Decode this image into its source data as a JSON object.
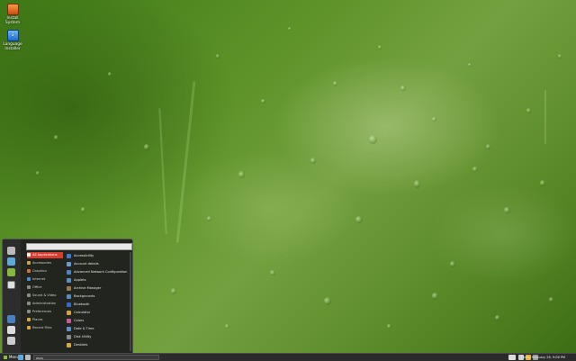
{
  "desktop": {
    "icons": [
      {
        "label": "Install System",
        "icon": "installer-icon"
      },
      {
        "label": "Language Installer",
        "icon": "language-icon"
      }
    ]
  },
  "menu": {
    "search_placeholder": "",
    "categories": [
      {
        "label": "All Applications",
        "icon": "all-apps-icon",
        "color": "#d83c2e",
        "active": true
      },
      {
        "label": "Accessories",
        "icon": "accessories-icon",
        "color": "#c9a24a"
      },
      {
        "label": "Graphics",
        "icon": "graphics-icon",
        "color": "#e0703a"
      },
      {
        "label": "Internet",
        "icon": "internet-icon",
        "color": "#4a8fd6"
      },
      {
        "label": "Office",
        "icon": "office-icon",
        "color": "#8a8a8a"
      },
      {
        "label": "Sound & Video",
        "icon": "sound-video-icon",
        "color": "#8a8a8a"
      },
      {
        "label": "Administration",
        "icon": "administration-icon",
        "color": "#8a8a8a"
      },
      {
        "label": "Preferences",
        "icon": "preferences-icon",
        "color": "#8a8a8a"
      },
      {
        "label": "Places",
        "icon": "places-icon",
        "color": "#d9a83b"
      },
      {
        "label": "Recent Files",
        "icon": "recent-files-icon",
        "color": "#d9a83b"
      }
    ],
    "applications": [
      {
        "label": "Accessibility",
        "icon": "accessibility-icon",
        "color": "#3e7ad0"
      },
      {
        "label": "Account details",
        "icon": "account-icon",
        "color": "#6a9bd8"
      },
      {
        "label": "Advanced Network Configuration",
        "icon": "network-icon",
        "color": "#4a86c8"
      },
      {
        "label": "Applets",
        "icon": "applets-icon",
        "color": "#5a8fcc"
      },
      {
        "label": "Archive Manager",
        "icon": "archive-icon",
        "color": "#9a7a4a"
      },
      {
        "label": "Backgrounds",
        "icon": "backgrounds-icon",
        "color": "#4f8ec9"
      },
      {
        "label": "Bluetooth",
        "icon": "bluetooth-icon",
        "color": "#2d6fc8"
      },
      {
        "label": "Calculator",
        "icon": "calculator-icon",
        "color": "#d4a23a"
      },
      {
        "label": "Colors",
        "icon": "colors-icon",
        "color": "#c85a9a"
      },
      {
        "label": "Date & Time",
        "icon": "datetime-icon",
        "color": "#5a90cc"
      },
      {
        "label": "Disk Utility",
        "icon": "disk-icon",
        "color": "#8a8a8a"
      },
      {
        "label": "Desklets",
        "icon": "desklets-icon",
        "color": "#d9a83b"
      }
    ]
  },
  "panel": {
    "menu_label": "Menu",
    "task_label": "asus",
    "clock": "Friday February 26, 9:06 PM"
  }
}
